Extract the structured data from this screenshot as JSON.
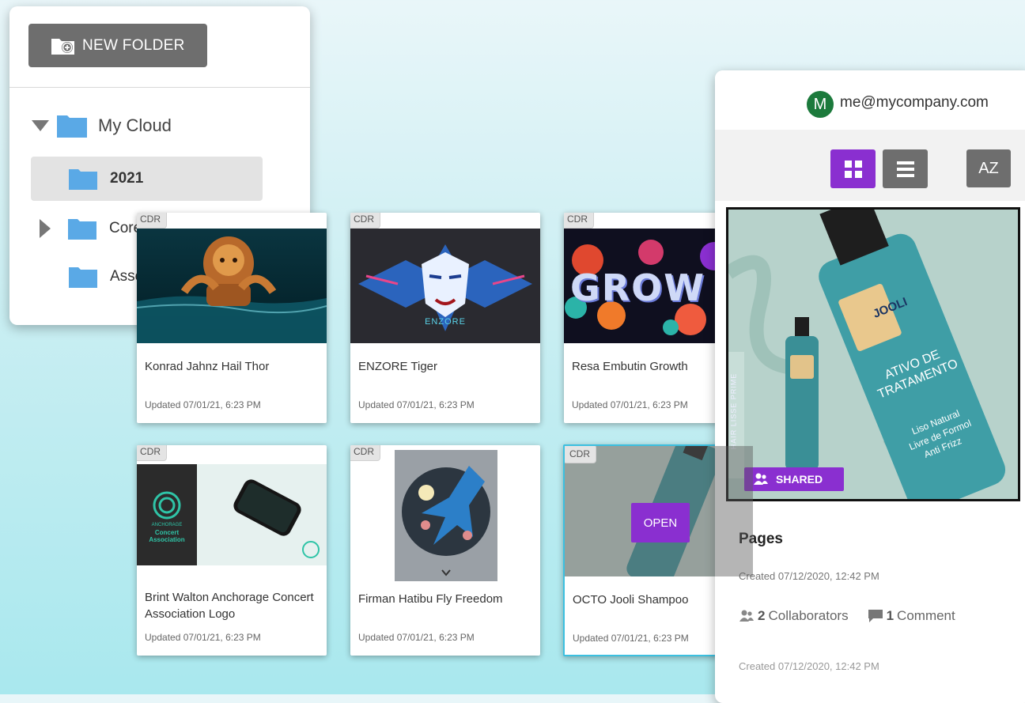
{
  "folder_panel": {
    "new_folder_label": "NEW FOLDER",
    "tree": [
      {
        "label": "My Cloud"
      },
      {
        "label": "2021"
      },
      {
        "label": "Core"
      },
      {
        "label": "Asse"
      }
    ]
  },
  "cards": [
    {
      "badge": "CDR",
      "title": "Konrad Jahnz Hail Thor",
      "updated": "Updated 07/01/21, 6:23 PM"
    },
    {
      "badge": "CDR",
      "title": "ENZORE Tiger",
      "updated": "Updated 07/01/21, 6:23 PM"
    },
    {
      "badge": "CDR",
      "title": "Resa Embutin Growth",
      "updated": "Updated 07/01/21, 6:23 PM"
    },
    {
      "badge": "CDR",
      "title": "Brint Walton Anchorage Concert Association Logo",
      "updated": "Updated 07/01/21, 6:23 PM"
    },
    {
      "badge": "CDR",
      "title": "Firman Hatibu Fly Freedom",
      "updated": "Updated 07/01/21, 6:23 PM"
    },
    {
      "badge": "CDR",
      "title": "OCTO Jooli Shampoo",
      "updated": "Updated 07/01/21, 6:23 PM",
      "open_label": "OPEN"
    }
  ],
  "thumb_text": {
    "enzore": "ENZORE",
    "grow": "GROW",
    "anchorage": "ANCHORAGE",
    "concert": "Concert Association"
  },
  "detail_panel": {
    "avatar_letter": "M",
    "email": "me@mycompany.com",
    "sort_label": "AZ",
    "preview_text": {
      "brand": "JOOLI",
      "product_line1": "ATIVO DE",
      "product_line2": "TRATAMENTO",
      "claim1": "Liso Natural",
      "claim2": "Livre de Formol",
      "claim3": "Anti Frizz",
      "side_label": "HAIR LISSE PRIME"
    },
    "shared_label": "SHARED",
    "section_title": "Pages",
    "created": "Created 07/12/2020, 12:42 PM",
    "collaborators_count": "2",
    "collaborators_label": "Collaborators",
    "comments_count": "1",
    "comments_label": "Comment",
    "created_footer": "Created 07/12/2020, 12:42 PM"
  },
  "colors": {
    "accent_purple": "#8a2fd0",
    "button_gray": "#6e6e6e",
    "folder_blue": "#5aa9e6",
    "avatar_green": "#1c7a3c",
    "active_border": "#3cc0e0"
  }
}
